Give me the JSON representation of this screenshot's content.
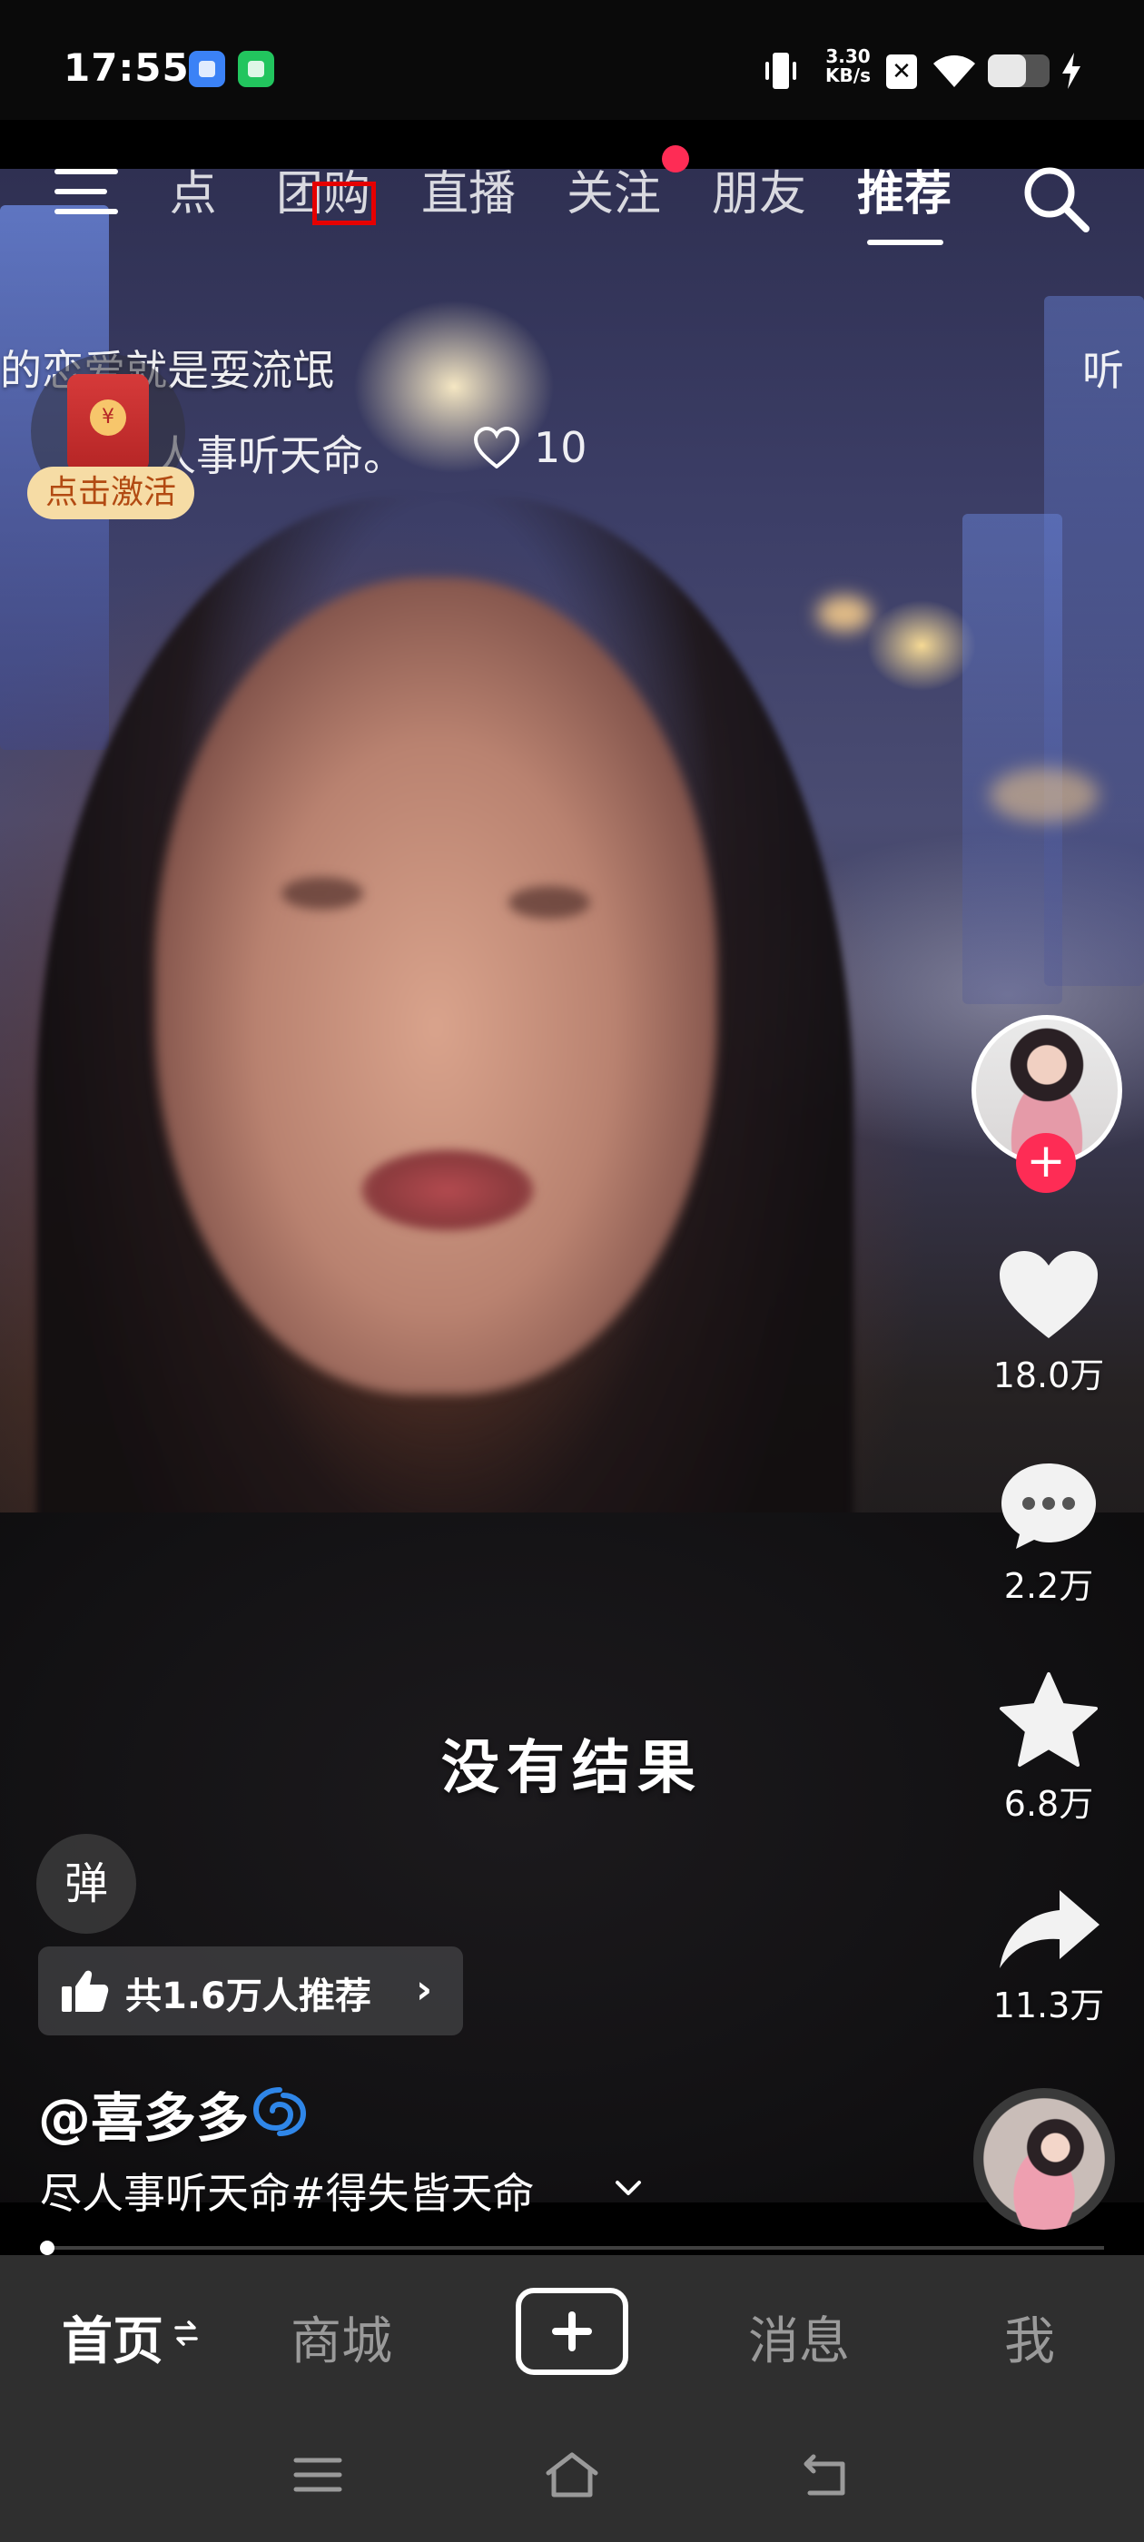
{
  "status_bar": {
    "time": "17:55",
    "net_speed_value": "3.30",
    "net_speed_unit": "KB/s",
    "sim_label": "✕",
    "battery_level": 0.62,
    "icons": [
      "app-notification-icon",
      "app-notification-icon",
      "vibrate-icon",
      "no-sim-icon",
      "wifi-icon",
      "battery-icon",
      "charging-icon"
    ]
  },
  "top_nav": {
    "tabs": [
      {
        "label": "热点",
        "shown": " 点"
      },
      {
        "label": "团购"
      },
      {
        "label": "直播"
      },
      {
        "label": "关注"
      },
      {
        "label": "朋友"
      },
      {
        "label": "推荐"
      }
    ],
    "active_tab": "推荐",
    "menu_icon": "hamburger-menu-icon",
    "search_icon": "search-icon"
  },
  "danmaku": {
    "line1": "的恋爱就是耍流氓",
    "line1_right": "听",
    "line2": "人事听天命。",
    "line2_likes": "10"
  },
  "red_packet": {
    "label": "点击激活",
    "seal": "¥"
  },
  "side_actions": {
    "likes": "18.0万",
    "comments": "2.2万",
    "favorites": "6.8万",
    "shares": "11.3万",
    "follow_symbol": "+"
  },
  "video": {
    "subtitle": "没有结果",
    "progress": 0.005
  },
  "danmaku_toggle": "弹",
  "recommend": {
    "text": "共1.6万人推荐",
    "chevron": "›"
  },
  "author": {
    "name": "@喜多多"
  },
  "caption": {
    "text": "尽人事听天命#得失皆天命"
  },
  "bottom_tabs": [
    {
      "label": "首页",
      "active": true
    },
    {
      "label": "商城"
    },
    {
      "label": "消息"
    },
    {
      "label": "我"
    }
  ],
  "colors": {
    "accent": "#fe2c55",
    "tabbar_bg": "#2f2f2f",
    "pill_bg": "#f6dca5",
    "pill_text": "#b24a12"
  }
}
